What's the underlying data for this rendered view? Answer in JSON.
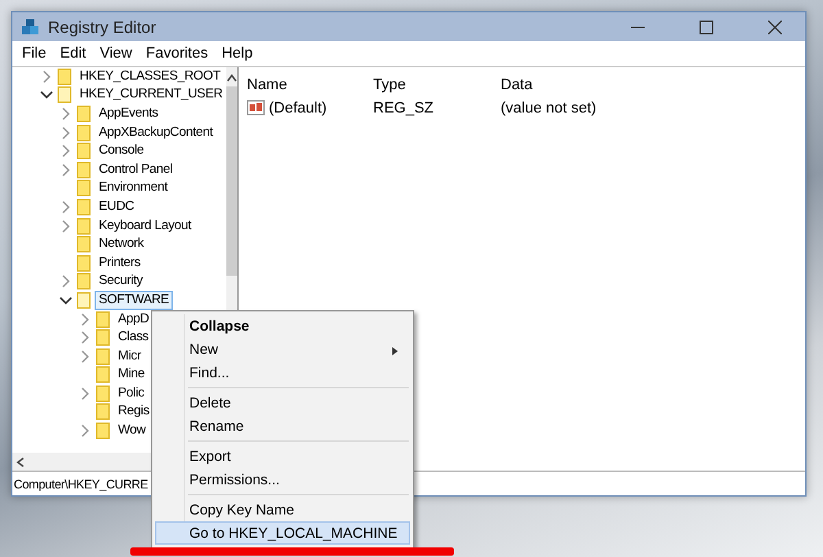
{
  "window": {
    "title": "Registry Editor"
  },
  "menu_bar": [
    "File",
    "Edit",
    "View",
    "Favorites",
    "Help"
  ],
  "tree": [
    {
      "label": "HKEY_CLASSES_ROOT",
      "expandable": true,
      "expanded": false,
      "selected": false
    },
    {
      "label": "HKEY_CURRENT_USER",
      "expandable": true,
      "expanded": true,
      "selected": false,
      "children": [
        {
          "label": "AppEvents",
          "expandable": true,
          "expanded": false,
          "selected": false
        },
        {
          "label": "AppXBackupContent",
          "expandable": true,
          "expanded": false,
          "selected": false
        },
        {
          "label": "Console",
          "expandable": true,
          "expanded": false,
          "selected": false
        },
        {
          "label": "Control Panel",
          "expandable": true,
          "expanded": false,
          "selected": false
        },
        {
          "label": "Environment",
          "expandable": false,
          "selected": false
        },
        {
          "label": "EUDC",
          "expandable": true,
          "expanded": false,
          "selected": false
        },
        {
          "label": "Keyboard Layout",
          "expandable": true,
          "expanded": false,
          "selected": false
        },
        {
          "label": "Network",
          "expandable": false,
          "selected": false
        },
        {
          "label": "Printers",
          "expandable": false,
          "selected": false
        },
        {
          "label": "Security",
          "expandable": true,
          "expanded": false,
          "selected": false
        },
        {
          "label": "SOFTWARE",
          "expandable": true,
          "expanded": true,
          "selected": true,
          "children": [
            {
              "label": "AppD",
              "expandable": true,
              "expanded": false,
              "selected": false
            },
            {
              "label": "Class",
              "expandable": true,
              "expanded": false,
              "selected": false
            },
            {
              "label": "Micr",
              "expandable": true,
              "expanded": false,
              "selected": false
            },
            {
              "label": "Mine",
              "expandable": false,
              "selected": false
            },
            {
              "label": "Polic",
              "expandable": true,
              "expanded": false,
              "selected": false
            },
            {
              "label": "Regis",
              "expandable": false,
              "selected": false
            },
            {
              "label": "Wow",
              "expandable": true,
              "expanded": false,
              "selected": false
            }
          ]
        }
      ]
    }
  ],
  "values_table": {
    "columns": [
      "Name",
      "Type",
      "Data"
    ],
    "rows": [
      {
        "name": "(Default)",
        "type": "REG_SZ",
        "data": "(value not set)"
      }
    ]
  },
  "status_bar": "Computer\\HKEY_CURRE",
  "context_menu": {
    "groups": [
      [
        {
          "label": "Collapse",
          "bold": true,
          "submenu": false,
          "selected": false
        },
        {
          "label": "New",
          "bold": false,
          "submenu": true,
          "selected": false
        },
        {
          "label": "Find...",
          "bold": false,
          "submenu": false,
          "selected": false
        }
      ],
      [
        {
          "label": "Delete",
          "bold": false,
          "submenu": false,
          "selected": false
        },
        {
          "label": "Rename",
          "bold": false,
          "submenu": false,
          "selected": false
        }
      ],
      [
        {
          "label": "Export",
          "bold": false,
          "submenu": false,
          "selected": false
        },
        {
          "label": "Permissions...",
          "bold": false,
          "submenu": false,
          "selected": false
        }
      ],
      [
        {
          "label": "Copy Key Name",
          "bold": false,
          "submenu": false,
          "selected": false
        },
        {
          "label": "Go to HKEY_LOCAL_MACHINE",
          "bold": false,
          "submenu": false,
          "selected": true
        }
      ]
    ]
  }
}
